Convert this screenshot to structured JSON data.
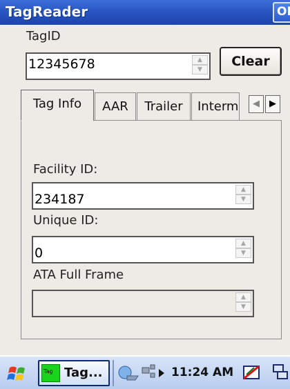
{
  "window": {
    "title": "TagReader",
    "ok_label": "OK"
  },
  "tag_id": {
    "label": "TagID",
    "value": "12345678"
  },
  "clear_button": {
    "label": "Clear"
  },
  "tabs": [
    {
      "label": "Tag Info",
      "active": true
    },
    {
      "label": "AAR",
      "active": false
    },
    {
      "label": "Trailer",
      "active": false
    },
    {
      "label": "Interm",
      "active": false
    }
  ],
  "tag_info": {
    "facility_id": {
      "label": "Facility ID:",
      "value": "234187"
    },
    "unique_id": {
      "label": "Unique ID:",
      "value": "0"
    },
    "ata_full_frame": {
      "label": "ATA Full Frame",
      "value": ""
    }
  },
  "taskbar": {
    "app_icon_text": "Tag",
    "task_label": "Tag...",
    "clock": "11:24 AM"
  },
  "colors": {
    "titlebar": "#2a56c4",
    "app_icon": "#19d31c"
  }
}
